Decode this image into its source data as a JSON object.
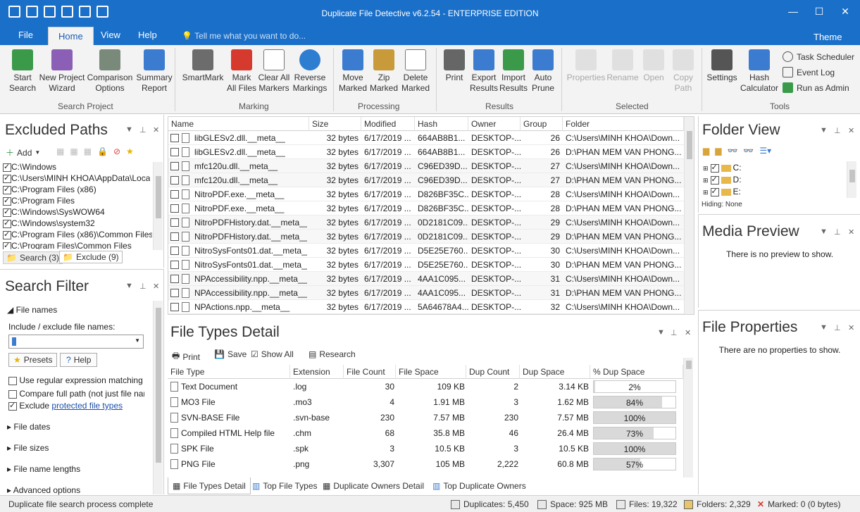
{
  "window": {
    "title": "Duplicate File Detective v6.2.54 - ENTERPRISE EDITION",
    "minimize": "—",
    "maximize": "☐",
    "close": "✕"
  },
  "ribbon_tabs": [
    "File",
    "Home",
    "View",
    "Help"
  ],
  "tell_me": "Tell me what you want to do...",
  "theme": "Theme",
  "ribbon": {
    "search_project": {
      "label": "Search Project",
      "buttons": [
        "Start\nSearch",
        "New Project\nWizard",
        "Comparison\nOptions",
        "Summary\nReport"
      ]
    },
    "marking": {
      "label": "Marking",
      "buttons": [
        "SmartMark",
        "Mark\nAll Files",
        "Clear All\nMarkers",
        "Reverse\nMarkings"
      ]
    },
    "processing": {
      "label": "Processing",
      "buttons": [
        "Move\nMarked",
        "Zip\nMarked",
        "Delete\nMarked"
      ]
    },
    "results": {
      "label": "Results",
      "buttons": [
        "Print",
        "Export\nResults",
        "Import\nResults",
        "Auto\nPrune"
      ]
    },
    "selected": {
      "label": "Selected",
      "buttons": [
        "Properties",
        "Rename",
        "Open",
        "Copy\nPath"
      ]
    },
    "tools": {
      "label": "Tools",
      "buttons": [
        "Settings",
        "Hash\nCalculator"
      ],
      "small": [
        "Task Scheduler",
        "Event Log",
        "Run as Admin"
      ]
    }
  },
  "excluded_paths": {
    "title": "Excluded Paths",
    "add": "Add",
    "paths": [
      "C:\\Windows",
      "C:\\Users\\MINH KHOA\\AppData\\Loca",
      "C:\\Program Files (x86)",
      "C:\\Program Files",
      "C:\\Windows\\SysWOW64",
      "C:\\Windows\\system32",
      "C:\\Program Files (x86)\\Common Files",
      "C:\\Program Files\\Common Files"
    ],
    "tabs": [
      "Search (3)",
      "Exclude (9)"
    ]
  },
  "search_filter": {
    "title": "Search Filter",
    "file_names": "File names",
    "include_label": "Include / exclude file names:",
    "presets": "Presets",
    "help": "Help",
    "opt_regex": "Use regular expression matching",
    "opt_fullpath": "Compare full path (not just file name)",
    "opt_exclude": "Exclude",
    "opt_exclude_link": "protected file types",
    "sections": [
      "File dates",
      "File sizes",
      "File name lengths",
      "Advanced options"
    ]
  },
  "results_grid": {
    "columns": [
      "Name",
      "Size",
      "Modified",
      "Hash",
      "Owner",
      "Group",
      "Folder"
    ],
    "rows": [
      [
        "libGLESv2.dll.__meta__",
        "32 bytes",
        "6/17/2019 ...",
        "664AB8B1...",
        "DESKTOP-...",
        "26",
        "C:\\Users\\MINH KHOA\\Down..."
      ],
      [
        "libGLESv2.dll.__meta__",
        "32 bytes",
        "6/17/2019 ...",
        "664AB8B1...",
        "DESKTOP-...",
        "26",
        "D:\\PHAN MEM VAN PHONG..."
      ],
      [
        "mfc120u.dll.__meta__",
        "32 bytes",
        "6/17/2019 ...",
        "C96ED39D...",
        "DESKTOP-...",
        "27",
        "C:\\Users\\MINH KHOA\\Down..."
      ],
      [
        "mfc120u.dll.__meta__",
        "32 bytes",
        "6/17/2019 ...",
        "C96ED39D...",
        "DESKTOP-...",
        "27",
        "D:\\PHAN MEM VAN PHONG..."
      ],
      [
        "NitroPDF.exe.__meta__",
        "32 bytes",
        "6/17/2019 ...",
        "D826BF35C...",
        "DESKTOP-...",
        "28",
        "C:\\Users\\MINH KHOA\\Down..."
      ],
      [
        "NitroPDF.exe.__meta__",
        "32 bytes",
        "6/17/2019 ...",
        "D826BF35C...",
        "DESKTOP-...",
        "28",
        "D:\\PHAN MEM VAN PHONG..."
      ],
      [
        "NitroPDFHistory.dat.__meta__",
        "32 bytes",
        "6/17/2019 ...",
        "0D2181C09...",
        "DESKTOP-...",
        "29",
        "C:\\Users\\MINH KHOA\\Down..."
      ],
      [
        "NitroPDFHistory.dat.__meta__",
        "32 bytes",
        "6/17/2019 ...",
        "0D2181C09...",
        "DESKTOP-...",
        "29",
        "D:\\PHAN MEM VAN PHONG..."
      ],
      [
        "NitroSysFonts01.dat.__meta__",
        "32 bytes",
        "6/17/2019 ...",
        "D5E25E760...",
        "DESKTOP-...",
        "30",
        "C:\\Users\\MINH KHOA\\Down..."
      ],
      [
        "NitroSysFonts01.dat.__meta__",
        "32 bytes",
        "6/17/2019 ...",
        "D5E25E760...",
        "DESKTOP-...",
        "30",
        "D:\\PHAN MEM VAN PHONG..."
      ],
      [
        "NPAccessibility.npp.__meta__",
        "32 bytes",
        "6/17/2019 ...",
        "4AA1C095...",
        "DESKTOP-...",
        "31",
        "C:\\Users\\MINH KHOA\\Down..."
      ],
      [
        "NPAccessibility.npp.__meta__",
        "32 bytes",
        "6/17/2019 ...",
        "4AA1C095...",
        "DESKTOP-...",
        "31",
        "D:\\PHAN MEM VAN PHONG..."
      ],
      [
        "NPActions.npp.__meta__",
        "32 bytes",
        "6/17/2019 ...",
        "5A64678A4...",
        "DESKTOP-...",
        "32",
        "C:\\Users\\MINH KHOA\\Down..."
      ]
    ]
  },
  "file_types": {
    "title": "File Types Detail",
    "toolbar": [
      "Print",
      "Save",
      "Show All",
      "Research"
    ],
    "columns": [
      "File Type",
      "Extension",
      "File Count",
      "File Space",
      "Dup Count",
      "Dup Space",
      "% Dup Space"
    ],
    "rows": [
      {
        "type": "Text Document",
        "ext": ".log",
        "count": "30",
        "space": "109 KB",
        "dup": "2",
        "dupspace": "3.14 KB",
        "pct": "2%",
        "pct_value": 2
      },
      {
        "type": "MO3 File",
        "ext": ".mo3",
        "count": "4",
        "space": "1.91 MB",
        "dup": "3",
        "dupspace": "1.62 MB",
        "pct": "84%",
        "pct_value": 84
      },
      {
        "type": "SVN-BASE File",
        "ext": ".svn-base",
        "count": "230",
        "space": "7.57 MB",
        "dup": "230",
        "dupspace": "7.57 MB",
        "pct": "100%",
        "pct_value": 100
      },
      {
        "type": "Compiled HTML Help file",
        "ext": ".chm",
        "count": "68",
        "space": "35.8 MB",
        "dup": "46",
        "dupspace": "26.4 MB",
        "pct": "73%",
        "pct_value": 73
      },
      {
        "type": "SPK File",
        "ext": ".spk",
        "count": "3",
        "space": "10.5 KB",
        "dup": "3",
        "dupspace": "10.5 KB",
        "pct": "100%",
        "pct_value": 100
      },
      {
        "type": "PNG File",
        "ext": ".png",
        "count": "3,307",
        "space": "105 MB",
        "dup": "2,222",
        "dupspace": "60.8 MB",
        "pct": "57%",
        "pct_value": 57
      }
    ],
    "tabs": [
      "File Types Detail",
      "Top File Types",
      "Duplicate Owners Detail",
      "Top Duplicate Owners"
    ]
  },
  "folder_view": {
    "title": "Folder View",
    "drives": [
      "C:",
      "D:",
      "E:"
    ],
    "hiding": "Hiding: None"
  },
  "media_preview": {
    "title": "Media Preview",
    "empty": "There is no preview to show."
  },
  "file_properties": {
    "title": "File Properties",
    "empty": "There are no properties to show."
  },
  "status": {
    "message": "Duplicate file search process complete",
    "duplicates": "Duplicates: 5,450",
    "space": "Space: 925 MB",
    "files": "Files: 19,322",
    "folders": "Folders: 2,329",
    "marked": "Marked: 0 (0 bytes)"
  },
  "colors": {
    "accent": "#1a6fc9",
    "ribbon_bg": "#f3f3f3",
    "bar_fill": "#d9d9d9"
  }
}
